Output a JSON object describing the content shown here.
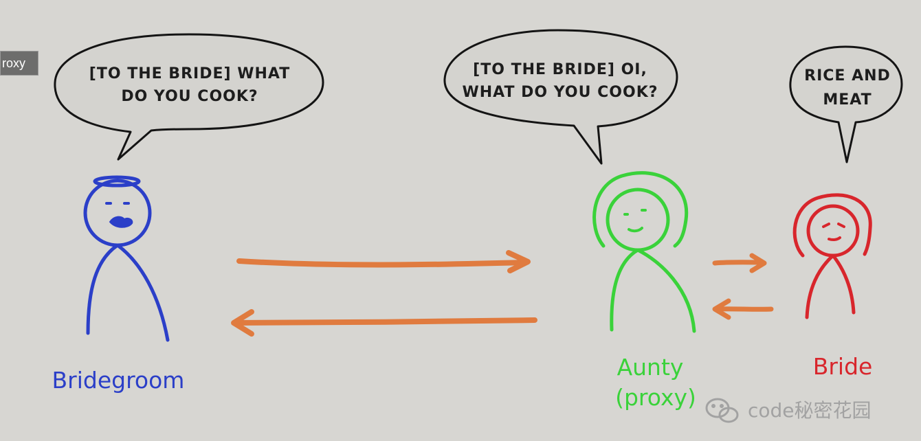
{
  "tooltip": {
    "text": "roxy"
  },
  "bubbles": {
    "groom": {
      "line1": "[TO THE BRIDE] WHAT",
      "line2": "DO YOU COOK?"
    },
    "aunty": {
      "line1": "[TO THE BRIDE] OI,",
      "line2": "WHAT DO YOU COOK?"
    },
    "bride": {
      "line1": "RICE AND",
      "line2": "MEAT"
    }
  },
  "labels": {
    "groom": "Bridegroom",
    "aunty_line1": "Aunty",
    "aunty_line2": "(proxy)",
    "bride": "Bride"
  },
  "watermark": {
    "text": "code秘密花园",
    "icon": "wechat-icon"
  },
  "colors": {
    "background": "#d7d6d2",
    "groom": "#2b3fc8",
    "aunty": "#3ad23a",
    "bride": "#d8262c",
    "arrow": "#e07b3f"
  }
}
